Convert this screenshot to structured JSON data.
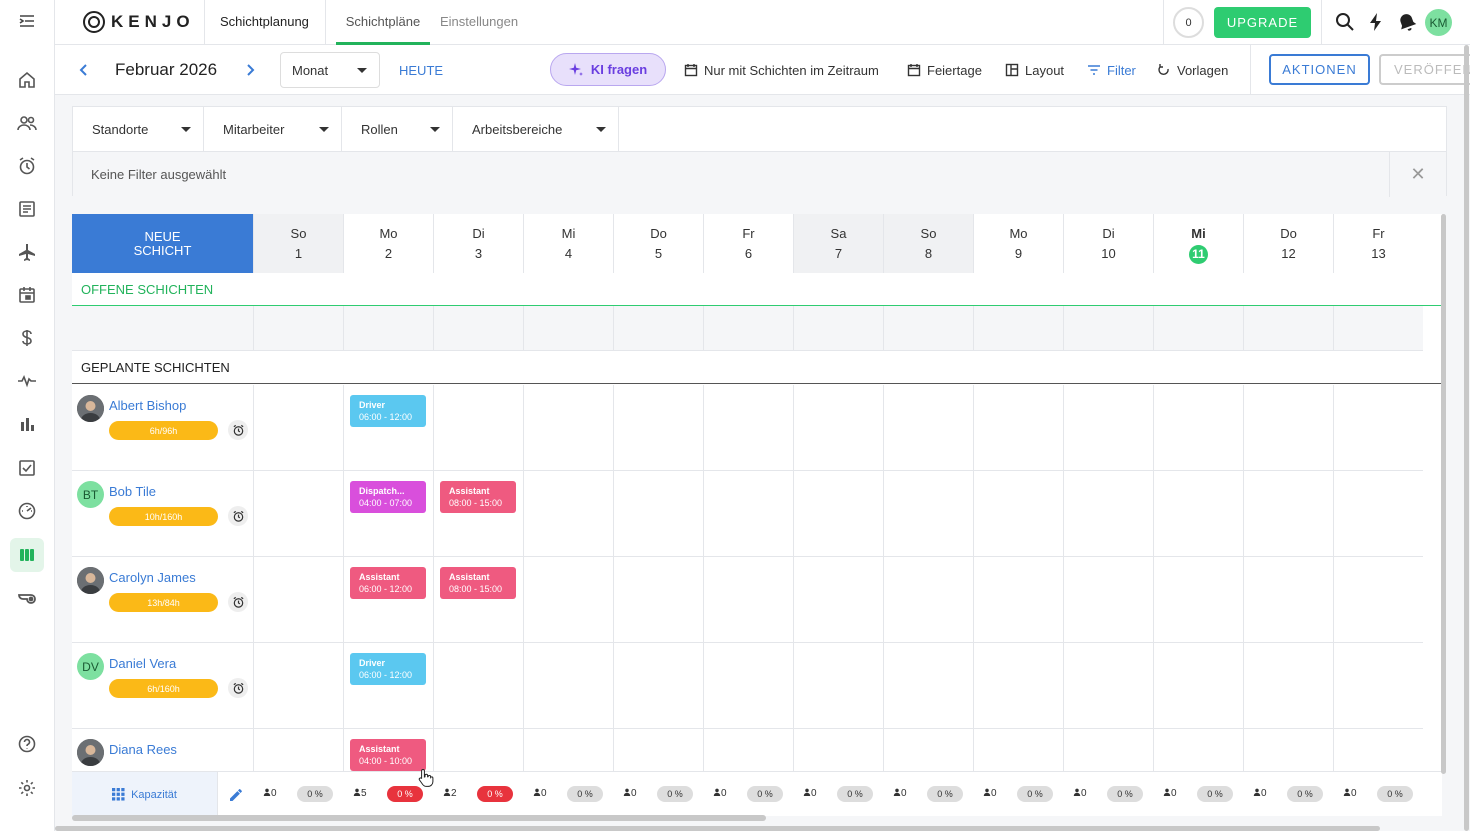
{
  "app": {
    "logo_text": "KENJO",
    "brand_color": "#22b35b"
  },
  "sidebar": {
    "items": [
      {
        "icon": "menu-expand-icon"
      },
      {
        "icon": "home-icon"
      },
      {
        "icon": "people-icon"
      },
      {
        "icon": "alarm-clock-icon"
      },
      {
        "icon": "document-icon"
      },
      {
        "icon": "airplane-icon"
      },
      {
        "icon": "calendar-icon"
      },
      {
        "icon": "dollar-icon"
      },
      {
        "icon": "pulse-icon"
      },
      {
        "icon": "bar-chart-icon"
      },
      {
        "icon": "checkbox-icon"
      },
      {
        "icon": "gauge-icon"
      },
      {
        "icon": "shift-planning-icon",
        "active": true
      },
      {
        "icon": "whistle-icon"
      },
      {
        "icon": "help-icon"
      },
      {
        "icon": "settings-icon"
      }
    ]
  },
  "topbar": {
    "section": "Schichtplanung",
    "tabs": [
      "Schichtpläne",
      "Einstellungen"
    ],
    "active_tab": "Schichtpläne",
    "counter": "0",
    "upgrade": "UPGRADE",
    "user_initials": "KM"
  },
  "toolbar": {
    "period": "Februar 2026",
    "view": "Monat",
    "today": "HEUTE",
    "ki": "KI fragen",
    "only_shifts": "Nur mit Schichten im Zeitraum",
    "holidays": "Feiertage",
    "layout": "Layout",
    "filter": "Filter",
    "templates": "Vorlagen",
    "actions": "AKTIONEN",
    "publish": "VERÖFFEN"
  },
  "filters": {
    "selects": [
      "Standorte",
      "Mitarbeiter",
      "Rollen",
      "Arbeitsbereiche"
    ],
    "none": "Keine Filter ausgewählt",
    "close": "✕"
  },
  "schedule": {
    "new_shift": "NEUE\nSCHICHT",
    "days": [
      {
        "label": "So",
        "num": "1",
        "weekend": true
      },
      {
        "label": "Mo",
        "num": "2"
      },
      {
        "label": "Di",
        "num": "3"
      },
      {
        "label": "Mi",
        "num": "4"
      },
      {
        "label": "Do",
        "num": "5"
      },
      {
        "label": "Fr",
        "num": "6"
      },
      {
        "label": "Sa",
        "num": "7",
        "weekend": true
      },
      {
        "label": "So",
        "num": "8",
        "weekend": true
      },
      {
        "label": "Mo",
        "num": "9"
      },
      {
        "label": "Di",
        "num": "10"
      },
      {
        "label": "Mi",
        "num": "11",
        "today": true
      },
      {
        "label": "Do",
        "num": "12"
      },
      {
        "label": "Fr",
        "num": "13"
      }
    ],
    "open_shifts": "OFFENE SCHICHTEN",
    "planned_shifts": "GEPLANTE SCHICHTEN",
    "employees": [
      {
        "name": "Albert Bishop",
        "hours": "6h/96h",
        "avatar": "photo",
        "shifts": [
          {
            "day": 1,
            "role": "Driver",
            "time": "06:00 - 12:00",
            "kind": "driver"
          }
        ]
      },
      {
        "name": "Bob Tile",
        "hours": "10h/160h",
        "avatar": "initials",
        "initials": "BT",
        "shifts": [
          {
            "day": 1,
            "role": "Dispatch...",
            "time": "04:00 - 07:00",
            "kind": "dispatch"
          },
          {
            "day": 2,
            "role": "Assistant",
            "time": "08:00 - 15:00",
            "kind": "assistant"
          }
        ]
      },
      {
        "name": "Carolyn James",
        "hours": "13h/84h",
        "avatar": "photo",
        "shifts": [
          {
            "day": 1,
            "role": "Assistant",
            "time": "06:00 - 12:00",
            "kind": "assistant"
          },
          {
            "day": 2,
            "role": "Assistant",
            "time": "08:00 - 15:00",
            "kind": "assistant"
          }
        ]
      },
      {
        "name": "Daniel Vera",
        "hours": "6h/160h",
        "avatar": "initials",
        "initials": "DV",
        "shifts": [
          {
            "day": 1,
            "role": "Driver",
            "time": "06:00 - 12:00",
            "kind": "driver"
          }
        ]
      },
      {
        "name": "Diana Rees",
        "hours": "",
        "avatar": "photo",
        "shifts": [
          {
            "day": 1,
            "role": "Assistant",
            "time": "04:00 - 10:00",
            "kind": "assistant"
          }
        ]
      }
    ],
    "capacity_label": "Kapazität",
    "capacity": [
      {
        "count": "0",
        "pct": "0 %"
      },
      {
        "count": "5",
        "pct": "0 %",
        "alert": true
      },
      {
        "count": "2",
        "pct": "0 %",
        "alert": true
      },
      {
        "count": "0",
        "pct": "0 %"
      },
      {
        "count": "0",
        "pct": "0 %"
      },
      {
        "count": "0",
        "pct": "0 %"
      },
      {
        "count": "0",
        "pct": "0 %"
      },
      {
        "count": "0",
        "pct": "0 %"
      },
      {
        "count": "0",
        "pct": "0 %"
      },
      {
        "count": "0",
        "pct": "0 %"
      },
      {
        "count": "0",
        "pct": "0 %"
      },
      {
        "count": "0",
        "pct": "0 %"
      },
      {
        "count": "0",
        "pct": "0 %"
      }
    ]
  }
}
